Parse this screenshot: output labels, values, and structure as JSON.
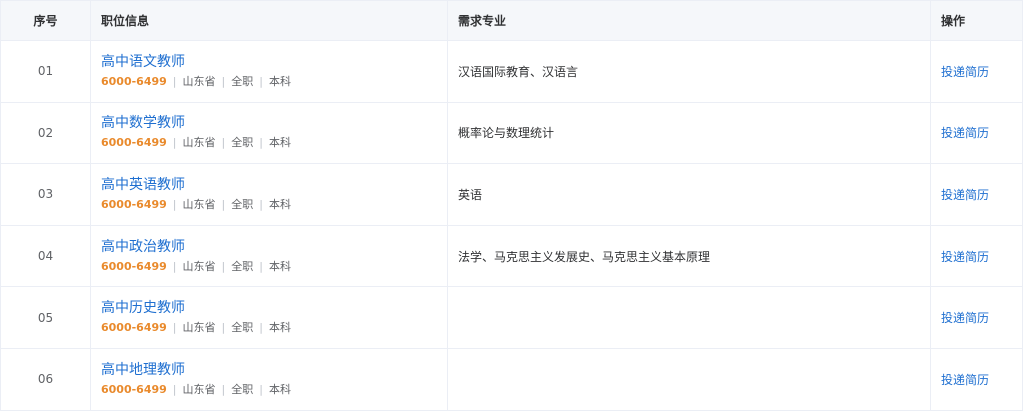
{
  "table": {
    "headers": {
      "no": "序号",
      "job": "职位信息",
      "major": "需求专业",
      "action": "操作"
    },
    "rows": [
      {
        "no": "01",
        "title": "高中语文教师",
        "salary": "6000-6499",
        "province": "山东省",
        "type": "全职",
        "edu": "本科",
        "major": "汉语国际教育、汉语言",
        "action": "投递简历"
      },
      {
        "no": "02",
        "title": "高中数学教师",
        "salary": "6000-6499",
        "province": "山东省",
        "type": "全职",
        "edu": "本科",
        "major": "概率论与数理统计",
        "action": "投递简历"
      },
      {
        "no": "03",
        "title": "高中英语教师",
        "salary": "6000-6499",
        "province": "山东省",
        "type": "全职",
        "edu": "本科",
        "major": "英语",
        "action": "投递简历"
      },
      {
        "no": "04",
        "title": "高中政治教师",
        "salary": "6000-6499",
        "province": "山东省",
        "type": "全职",
        "edu": "本科",
        "major": "法学、马克思主义发展史、马克思主义基本原理",
        "action": "投递简历"
      },
      {
        "no": "05",
        "title": "高中历史教师",
        "salary": "6000-6499",
        "province": "山东省",
        "type": "全职",
        "edu": "本科",
        "major": "",
        "action": "投递简历"
      },
      {
        "no": "06",
        "title": "高中地理教师",
        "salary": "6000-6499",
        "province": "山东省",
        "type": "全职",
        "edu": "本科",
        "major": "",
        "action": "投递简历"
      }
    ]
  }
}
